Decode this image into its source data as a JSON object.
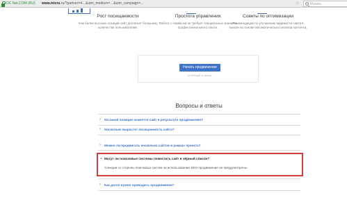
{
  "browser": {
    "secure_label": "OC Net.COM (RU)",
    "url_domain": "www.micru",
    "url_rest": ".ru/?partner=4…&utm_medium=…&utm_campaign=…",
    "search_placeholder": "Искать"
  },
  "features": [
    {
      "title": "Рост посещаемости",
      "text": "Чем более высоких позиций сайт достигает большему количестве пользователей."
    },
    {
      "title": "Простота управления",
      "text": "Работа с сервисом не требует специальных знаний и профессионального опыта."
    },
    {
      "title": "Советы по оптимизации",
      "text": "Рекомендации по улучшению видимости сайта в поиске на основе автоматического анализа контента."
    }
  ],
  "cta": {
    "button_label": "Начать продвижение",
    "note": "от 600 руб. в месяц"
  },
  "faq": {
    "title": "Вопросы и ответы",
    "items": [
      {
        "question": "На какой позиции окажется сайт в результате продвижения?"
      },
      {
        "question": "Насколько вырастет посещаемость сайта?"
      },
      {
        "question": "Можно ли продвигать несколько сайтов в рамках проекта?"
      },
      {
        "question": "Могут ли поисковые системы поместить сайт в чёрный список?",
        "answer": "Санкции со стороны поисковых систем за использование SEO-продвижение не предусмотрены."
      },
      {
        "question": "Как долго нужно проводить продвижение?"
      }
    ]
  },
  "colors": {
    "accent": "#3f73c6",
    "highlight": "#d43c3c",
    "secure": "#2e8b3c"
  }
}
